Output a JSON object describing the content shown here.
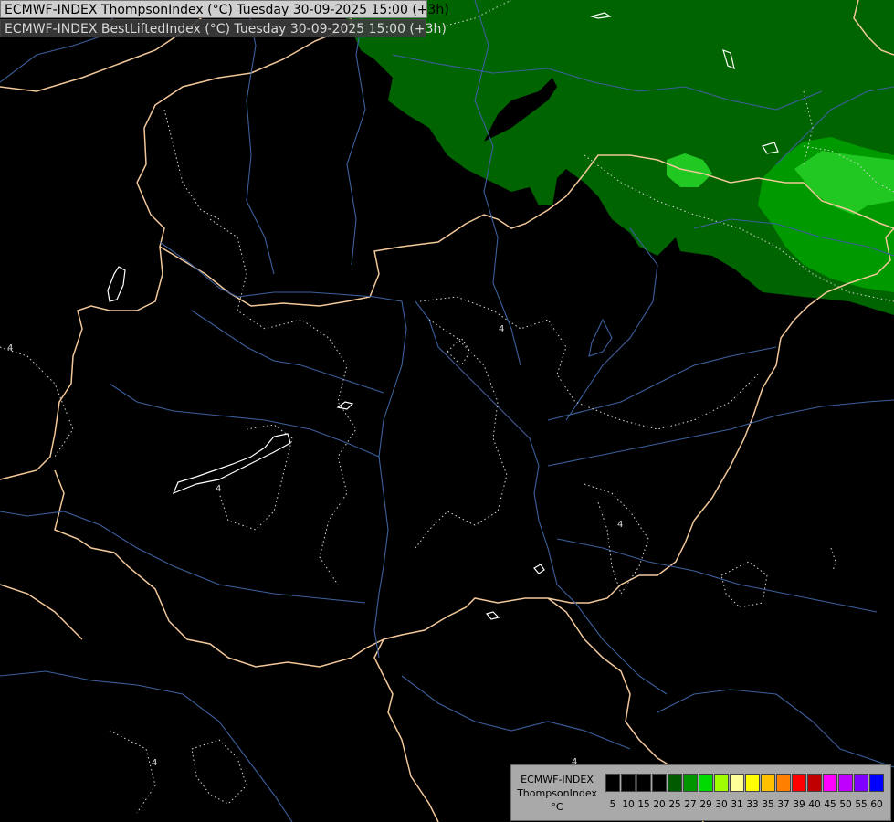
{
  "header": {
    "title_primary": "ECMWF-INDEX ThompsonIndex (°C) Tuesday 30-09-2025 15:00 (+3h)",
    "title_secondary": "ECMWF-INDEX BestLiftedIndex (°C) Tuesday 30-09-2025 15:00 (+3h)"
  },
  "map": {
    "contour_labels": [
      "4",
      "4",
      "4",
      "4",
      "4",
      "4"
    ],
    "colors": {
      "background": "#000000",
      "border": "#f2c89a",
      "river": "#3d5f9c",
      "contour": "#cfcfcf",
      "field_dark_green": "#006400",
      "field_green": "#009900",
      "field_light_green": "#22cc22"
    }
  },
  "legend": {
    "title_lines": [
      "ECMWF-INDEX",
      "ThompsonIndex",
      "°C"
    ],
    "swatches": [
      {
        "value": "5",
        "color": "#000000"
      },
      {
        "value": "10",
        "color": "#000000"
      },
      {
        "value": "15",
        "color": "#000000"
      },
      {
        "value": "20",
        "color": "#000000"
      },
      {
        "value": "25",
        "color": "#005a00"
      },
      {
        "value": "27",
        "color": "#009600"
      },
      {
        "value": "29",
        "color": "#00dc00"
      },
      {
        "value": "30",
        "color": "#a0ff00"
      },
      {
        "value": "31",
        "color": "#ffff99"
      },
      {
        "value": "33",
        "color": "#ffff00"
      },
      {
        "value": "35",
        "color": "#ffc000"
      },
      {
        "value": "37",
        "color": "#ff8000"
      },
      {
        "value": "39",
        "color": "#ff0000"
      },
      {
        "value": "40",
        "color": "#c00000"
      },
      {
        "value": "45",
        "color": "#ff00ff"
      },
      {
        "value": "50",
        "color": "#c000ff"
      },
      {
        "value": "55",
        "color": "#8000ff"
      },
      {
        "value": "60",
        "color": "#0000ff"
      }
    ]
  }
}
